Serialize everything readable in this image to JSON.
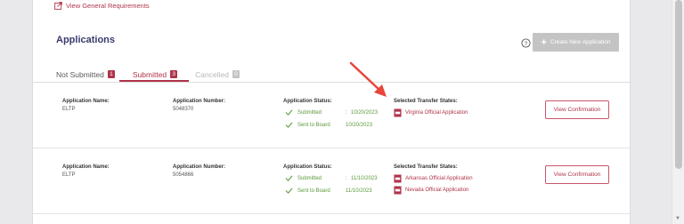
{
  "top_link": {
    "label": "View General Requirements"
  },
  "page": {
    "title": "Applications",
    "create_button": "Create New Application"
  },
  "tabs": [
    {
      "label": "Not Submitted",
      "count": "1"
    },
    {
      "label": "Submitted",
      "count": "3"
    },
    {
      "label": "Cancelled",
      "count": "0"
    }
  ],
  "labels": {
    "app_name": "Application Name:",
    "app_number": "Application Number:",
    "app_status": "Application Status:",
    "transfer_states": "Selected Transfer States:"
  },
  "applications": [
    {
      "name": "ELTP",
      "number": "5048370",
      "statuses": [
        {
          "label": "Submitted",
          "separator": ":",
          "date": "10/20/2023"
        },
        {
          "label": "Sent to Board",
          "separator": "",
          "date": "10/20/2023"
        }
      ],
      "states": [
        "Virginia Official Application"
      ],
      "confirm_label": "View Confirmation"
    },
    {
      "name": "ELTP",
      "number": "5054866",
      "statuses": [
        {
          "label": "Submitted",
          "separator": ":",
          "date": "11/10/2023"
        },
        {
          "label": "Sent to Board",
          "separator": "",
          "date": "11/10/2023"
        }
      ],
      "states": [
        "Arkansas Official Application",
        "Nevada Official Application"
      ],
      "confirm_label": "View Confirmation"
    }
  ],
  "colors": {
    "accent": "#b0334a",
    "title": "#3a3a6e",
    "success": "#5a9a3a",
    "annotation_arrow": "#e8453c"
  }
}
